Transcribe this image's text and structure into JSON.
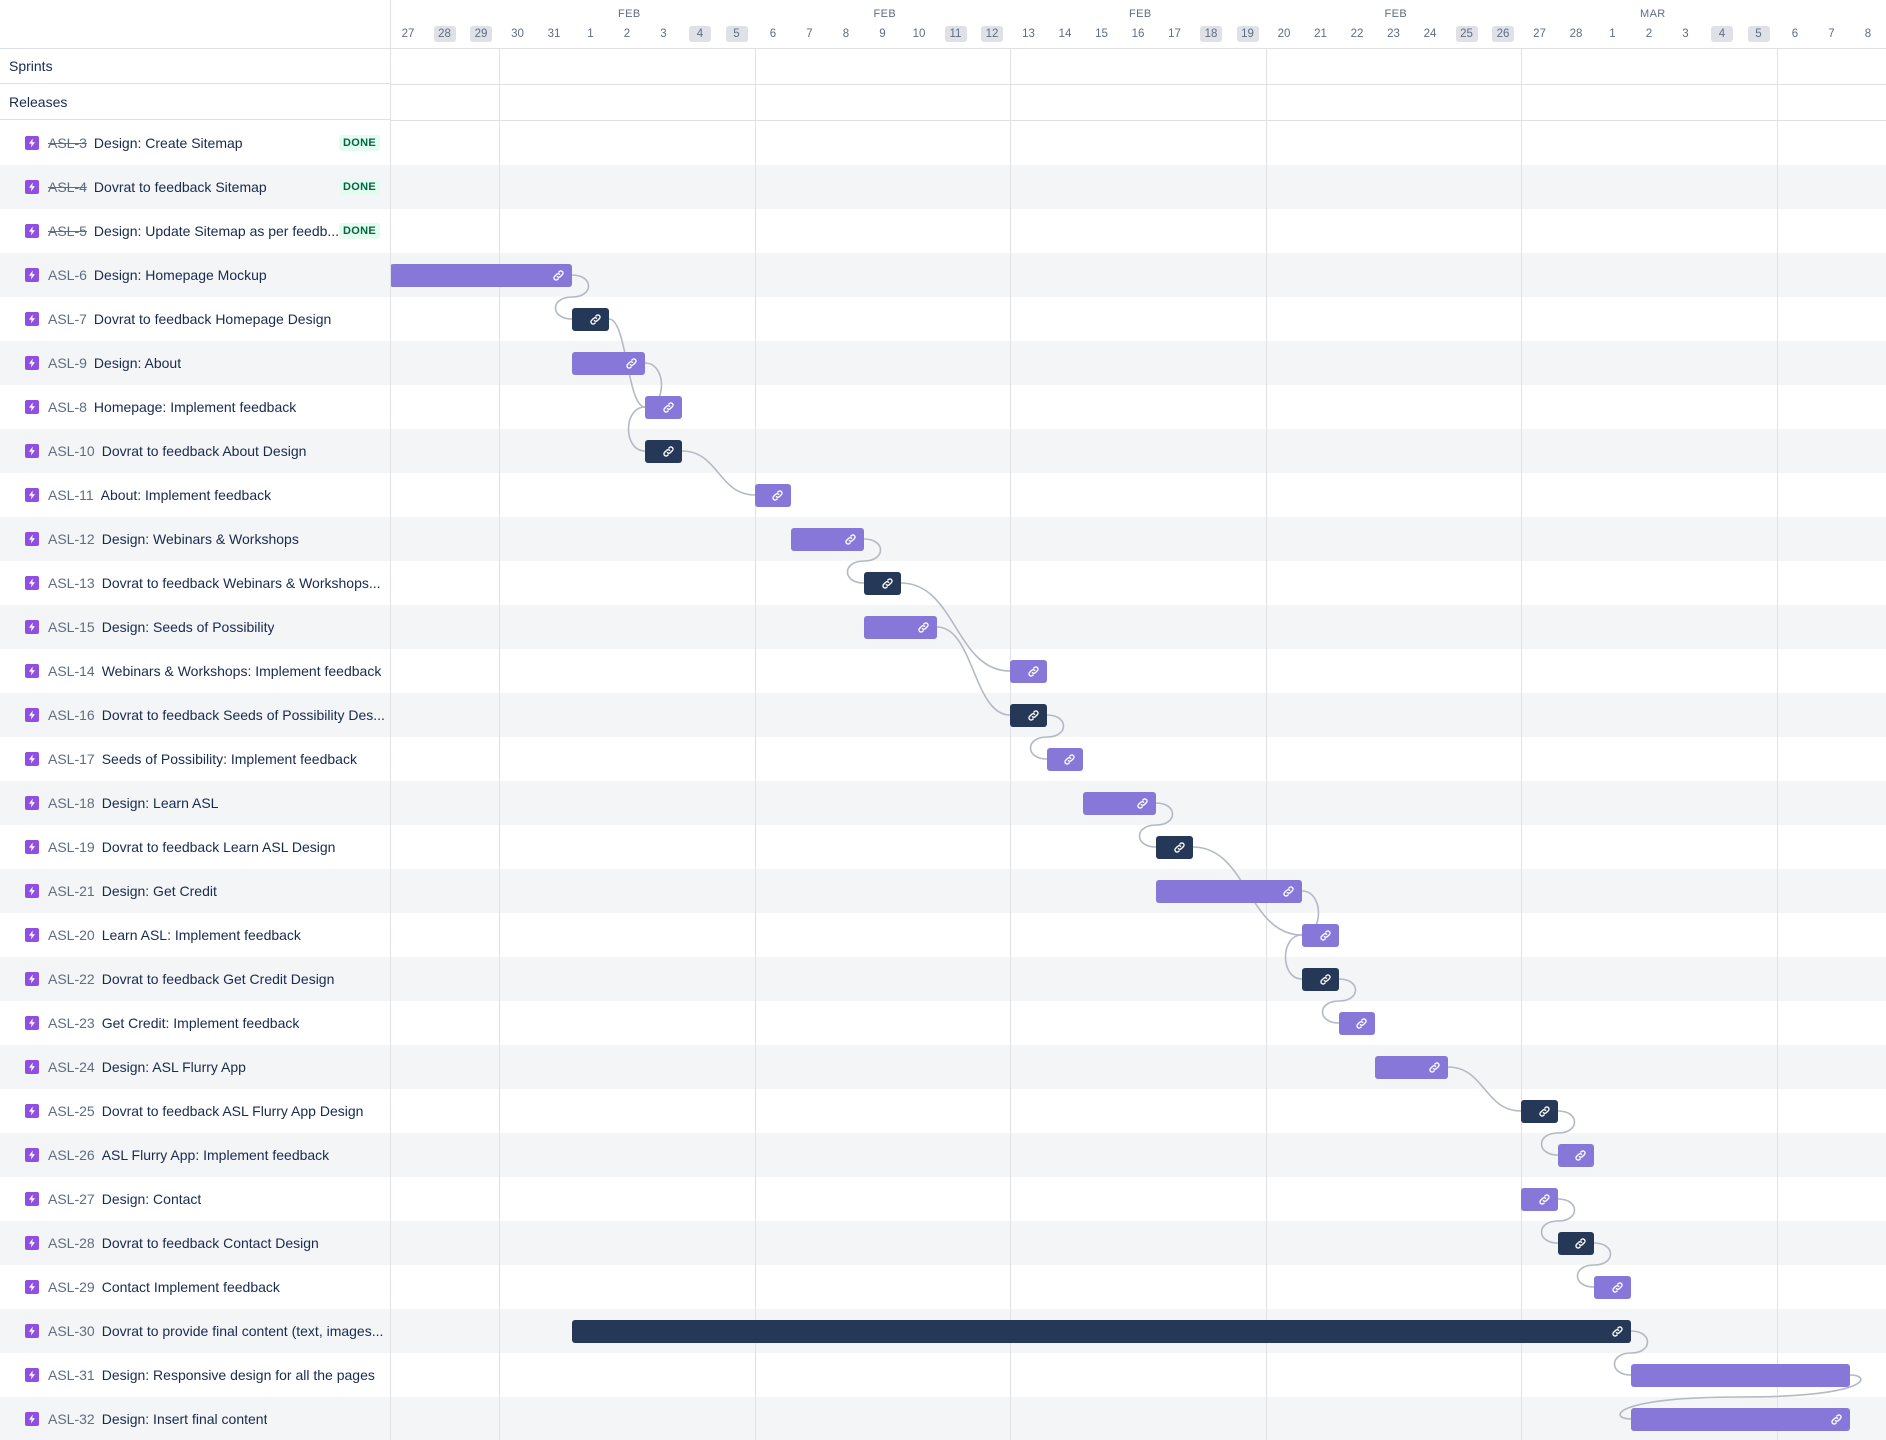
{
  "colors": {
    "task_bar": "#8777d9",
    "feedback_bar": "#253858",
    "issue_icon": "#904ee2",
    "done_badge_bg": "#e3fcef",
    "done_badge_text": "#006644"
  },
  "groups": [
    {
      "label": "Sprints"
    },
    {
      "label": "Releases"
    }
  ],
  "icons": {
    "issue_type": "lightning-icon",
    "bar_link": "link-icon"
  },
  "months": [
    "FEB",
    "FEB",
    "FEB",
    "FEB",
    "MAR"
  ],
  "days": [
    {
      "label": "27",
      "weekend": false
    },
    {
      "label": "28",
      "weekend": true
    },
    {
      "label": "29",
      "weekend": true
    },
    {
      "label": "30",
      "weekend": false
    },
    {
      "label": "31",
      "weekend": false
    },
    {
      "label": "1",
      "weekend": false
    },
    {
      "label": "2",
      "weekend": false
    },
    {
      "label": "3",
      "weekend": false
    },
    {
      "label": "4",
      "weekend": true
    },
    {
      "label": "5",
      "weekend": true
    },
    {
      "label": "6",
      "weekend": false
    },
    {
      "label": "7",
      "weekend": false
    },
    {
      "label": "8",
      "weekend": false
    },
    {
      "label": "9",
      "weekend": false
    },
    {
      "label": "10",
      "weekend": false
    },
    {
      "label": "11",
      "weekend": true
    },
    {
      "label": "12",
      "weekend": true
    },
    {
      "label": "13",
      "weekend": false
    },
    {
      "label": "14",
      "weekend": false
    },
    {
      "label": "15",
      "weekend": false
    },
    {
      "label": "16",
      "weekend": false
    },
    {
      "label": "17",
      "weekend": false
    },
    {
      "label": "18",
      "weekend": true
    },
    {
      "label": "19",
      "weekend": true
    },
    {
      "label": "20",
      "weekend": false
    },
    {
      "label": "21",
      "weekend": false
    },
    {
      "label": "22",
      "weekend": false
    },
    {
      "label": "23",
      "weekend": false
    },
    {
      "label": "24",
      "weekend": false
    },
    {
      "label": "25",
      "weekend": true
    },
    {
      "label": "26",
      "weekend": true
    },
    {
      "label": "27",
      "weekend": false
    },
    {
      "label": "28",
      "weekend": false
    },
    {
      "label": "1",
      "weekend": false
    },
    {
      "label": "2",
      "weekend": false
    },
    {
      "label": "3",
      "weekend": false
    },
    {
      "label": "4",
      "weekend": true
    },
    {
      "label": "5",
      "weekend": true
    },
    {
      "label": "6",
      "weekend": false
    },
    {
      "label": "7",
      "weekend": false
    },
    {
      "label": "8",
      "weekend": false
    }
  ],
  "issues": [
    {
      "key": "ASL-3",
      "title": "Design: Create Sitemap",
      "status": "DONE"
    },
    {
      "key": "ASL-4",
      "title": "Dovrat to feedback Sitemap",
      "status": "DONE"
    },
    {
      "key": "ASL-5",
      "title": "Design: Update Sitemap as per feedb...",
      "status": "DONE"
    },
    {
      "key": "ASL-6",
      "title": "Design: Homepage Mockup",
      "bar": {
        "start": -0.5,
        "end": 4.5,
        "type": "task",
        "link": true
      }
    },
    {
      "key": "ASL-7",
      "title": "Dovrat to feedback Homepage Design",
      "bar": {
        "start": 4.5,
        "end": 5.5,
        "type": "feedback",
        "link": true
      }
    },
    {
      "key": "ASL-9",
      "title": "Design: About",
      "bar": {
        "start": 4.5,
        "end": 6.5,
        "type": "task",
        "link": true
      }
    },
    {
      "key": "ASL-8",
      "title": "Homepage: Implement feedback",
      "bar": {
        "start": 6.5,
        "end": 7.5,
        "type": "task",
        "link": true
      }
    },
    {
      "key": "ASL-10",
      "title": "Dovrat to feedback About Design",
      "bar": {
        "start": 6.5,
        "end": 7.5,
        "type": "feedback",
        "link": true
      }
    },
    {
      "key": "ASL-11",
      "title": "About: Implement feedback",
      "bar": {
        "start": 9.5,
        "end": 10.5,
        "type": "task",
        "link": true
      }
    },
    {
      "key": "ASL-12",
      "title": "Design: Webinars & Workshops",
      "bar": {
        "start": 10.5,
        "end": 12.5,
        "type": "task",
        "link": true
      }
    },
    {
      "key": "ASL-13",
      "title": "Dovrat to feedback Webinars & Workshops...",
      "bar": {
        "start": 12.5,
        "end": 13.5,
        "type": "feedback",
        "link": true
      }
    },
    {
      "key": "ASL-15",
      "title": "Design: Seeds of Possibility",
      "bar": {
        "start": 12.5,
        "end": 14.5,
        "type": "task",
        "link": true
      }
    },
    {
      "key": "ASL-14",
      "title": "Webinars & Workshops: Implement feedback",
      "bar": {
        "start": 16.5,
        "end": 17.5,
        "type": "task",
        "link": true
      }
    },
    {
      "key": "ASL-16",
      "title": "Dovrat to feedback Seeds of Possibility Des...",
      "bar": {
        "start": 16.5,
        "end": 17.5,
        "type": "feedback",
        "link": true
      }
    },
    {
      "key": "ASL-17",
      "title": "Seeds of Possibility: Implement feedback",
      "bar": {
        "start": 17.5,
        "end": 18.5,
        "type": "task",
        "link": true
      }
    },
    {
      "key": "ASL-18",
      "title": "Design: Learn ASL",
      "bar": {
        "start": 18.5,
        "end": 20.5,
        "type": "task",
        "link": true
      }
    },
    {
      "key": "ASL-19",
      "title": "Dovrat to feedback Learn ASL Design",
      "bar": {
        "start": 20.5,
        "end": 21.5,
        "type": "feedback",
        "link": true
      }
    },
    {
      "key": "ASL-21",
      "title": "Design: Get Credit",
      "bar": {
        "start": 20.5,
        "end": 24.5,
        "type": "task",
        "link": true
      }
    },
    {
      "key": "ASL-20",
      "title": "Learn ASL: Implement feedback",
      "bar": {
        "start": 24.5,
        "end": 25.5,
        "type": "task",
        "link": true
      }
    },
    {
      "key": "ASL-22",
      "title": "Dovrat to feedback Get Credit Design",
      "bar": {
        "start": 24.5,
        "end": 25.5,
        "type": "feedback",
        "link": true
      }
    },
    {
      "key": "ASL-23",
      "title": "Get Credit: Implement feedback",
      "bar": {
        "start": 25.5,
        "end": 26.5,
        "type": "task",
        "link": true
      }
    },
    {
      "key": "ASL-24",
      "title": "Design: ASL Flurry App",
      "bar": {
        "start": 26.5,
        "end": 28.5,
        "type": "task",
        "link": true
      }
    },
    {
      "key": "ASL-25",
      "title": "Dovrat to feedback ASL Flurry App Design",
      "bar": {
        "start": 30.5,
        "end": 31.5,
        "type": "feedback",
        "link": true
      }
    },
    {
      "key": "ASL-26",
      "title": "ASL Flurry App: Implement feedback",
      "bar": {
        "start": 31.5,
        "end": 32.5,
        "type": "task",
        "link": true
      }
    },
    {
      "key": "ASL-27",
      "title": "Design: Contact",
      "bar": {
        "start": 30.5,
        "end": 31.5,
        "type": "task",
        "link": true
      }
    },
    {
      "key": "ASL-28",
      "title": "Dovrat to feedback Contact Design",
      "bar": {
        "start": 31.5,
        "end": 32.5,
        "type": "feedback",
        "link": true
      }
    },
    {
      "key": "ASL-29",
      "title": "Contact Implement feedback",
      "bar": {
        "start": 32.5,
        "end": 33.5,
        "type": "task",
        "link": true
      }
    },
    {
      "key": "ASL-30",
      "title": "Dovrat to provide final content (text, images...",
      "bar": {
        "start": 4.5,
        "end": 33.5,
        "type": "feedback",
        "link": true
      }
    },
    {
      "key": "ASL-31",
      "title": "Design: Responsive design for all the pages",
      "bar": {
        "start": 33.5,
        "end": 39.5,
        "type": "task",
        "link": false
      }
    },
    {
      "key": "ASL-32",
      "title": "Design: Insert final content",
      "bar": {
        "start": 33.5,
        "end": 39.5,
        "type": "task",
        "link": true
      }
    }
  ],
  "dependencies": [
    [
      "ASL-6",
      "ASL-7"
    ],
    [
      "ASL-7",
      "ASL-8"
    ],
    [
      "ASL-9",
      "ASL-10"
    ],
    [
      "ASL-10",
      "ASL-11"
    ],
    [
      "ASL-12",
      "ASL-13"
    ],
    [
      "ASL-13",
      "ASL-14"
    ],
    [
      "ASL-15",
      "ASL-16"
    ],
    [
      "ASL-16",
      "ASL-17"
    ],
    [
      "ASL-18",
      "ASL-19"
    ],
    [
      "ASL-19",
      "ASL-20"
    ],
    [
      "ASL-21",
      "ASL-22"
    ],
    [
      "ASL-22",
      "ASL-23"
    ],
    [
      "ASL-24",
      "ASL-25"
    ],
    [
      "ASL-25",
      "ASL-26"
    ],
    [
      "ASL-27",
      "ASL-28"
    ],
    [
      "ASL-28",
      "ASL-29"
    ],
    [
      "ASL-30",
      "ASL-31"
    ],
    [
      "ASL-31",
      "ASL-32"
    ]
  ]
}
